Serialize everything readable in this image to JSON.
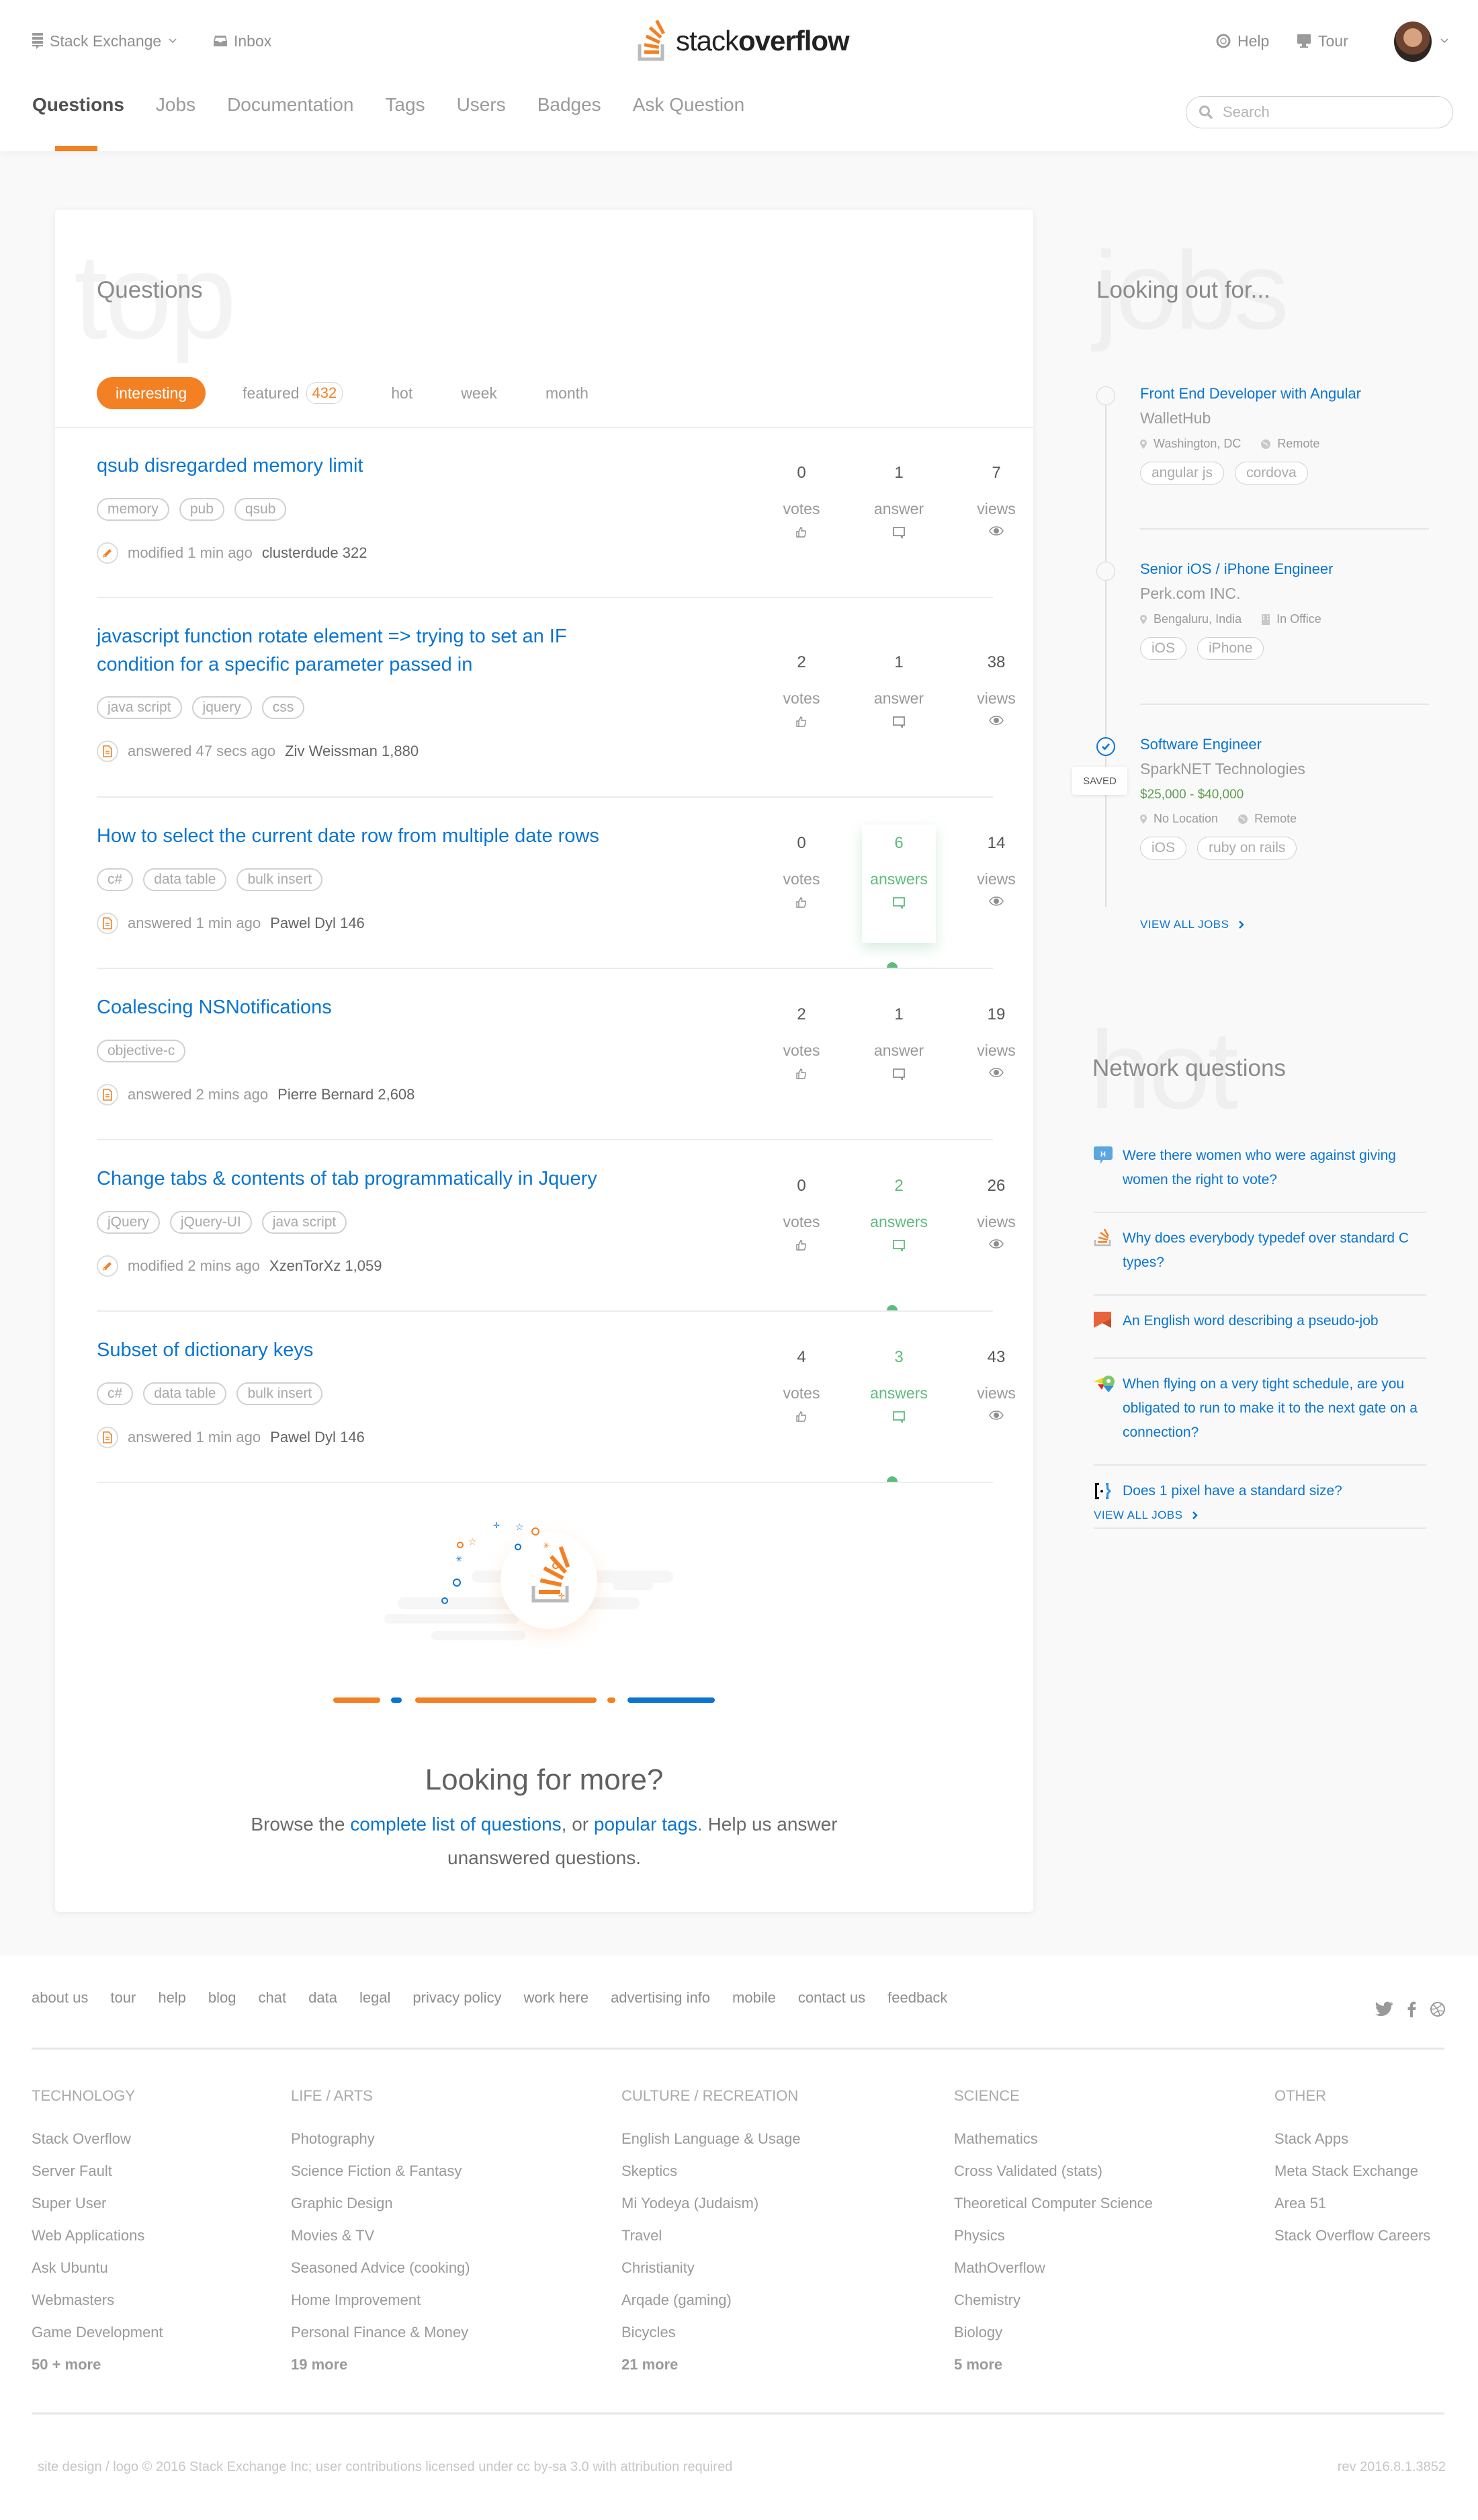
{
  "header": {
    "stack_exchange_label": "Stack Exchange",
    "inbox_label": "Inbox",
    "logo_text_light": "stack",
    "logo_text_bold": "overflow",
    "help_label": "Help",
    "tour_label": "Tour",
    "nav": [
      {
        "label": "Questions",
        "active": true
      },
      {
        "label": "Jobs"
      },
      {
        "label": "Documentation"
      },
      {
        "label": "Tags"
      },
      {
        "label": "Users"
      },
      {
        "label": "Badges"
      },
      {
        "label": "Ask Question"
      }
    ],
    "search_placeholder": "Search"
  },
  "main": {
    "watermark": "top",
    "title": "Questions",
    "filters": [
      {
        "label": "interesting",
        "active": true
      },
      {
        "label": "featured",
        "badge": "432"
      },
      {
        "label": "hot"
      },
      {
        "label": "week"
      },
      {
        "label": "month"
      }
    ],
    "questions": [
      {
        "title": "qsub disregarded memory limit",
        "tags": [
          "memory",
          "pub",
          "qsub"
        ],
        "action": "modified",
        "time": "1 min ago",
        "user": "clusterdude",
        "rep": "322",
        "action_icon": "pencil-icon",
        "votes": "0",
        "votes_label": "votes",
        "answers": "1",
        "answers_label": "answer",
        "answers_highlight": false,
        "accepted": false,
        "views": "7",
        "views_label": "views"
      },
      {
        "title": "javascript function rotate element => trying to set an IF condition for a specific parameter passed in",
        "tags": [
          "java script",
          "jquery",
          "css"
        ],
        "action": "answered",
        "time": "47 secs ago",
        "user": "Ziv Weissman",
        "rep": "1,880",
        "action_icon": "document-icon",
        "votes": "2",
        "votes_label": "votes",
        "answers": "1",
        "answers_label": "answer",
        "answers_highlight": false,
        "accepted": false,
        "views": "38",
        "views_label": "views"
      },
      {
        "title": "How to select the current date row from multiple date rows",
        "tags": [
          "c#",
          "data table",
          "bulk insert"
        ],
        "action": "answered",
        "time": "1 min ago",
        "user": "Pawel Dyl",
        "rep": "146",
        "action_icon": "document-icon",
        "votes": "0",
        "votes_label": "votes",
        "answers": "6",
        "answers_label": "answers",
        "answers_highlight": true,
        "accepted": true,
        "views": "14",
        "views_label": "views"
      },
      {
        "title": "Coalescing NSNotifications",
        "tags": [
          "objective-c"
        ],
        "action": "answered",
        "time": "2 mins ago",
        "user": "Pierre Bernard",
        "rep": "2,608",
        "action_icon": "document-icon",
        "votes": "2",
        "votes_label": "votes",
        "answers": "1",
        "answers_label": "answer",
        "answers_highlight": false,
        "accepted": false,
        "views": "19",
        "views_label": "views"
      },
      {
        "title": "Change tabs & contents of tab programmatically in Jquery",
        "tags": [
          "jQuery",
          "jQuery-UI",
          "java script"
        ],
        "action": "modified",
        "time": "2 mins ago",
        "user": "XzenTorXz",
        "rep": "1,059",
        "action_icon": "pencil-icon",
        "votes": "0",
        "votes_label": "votes",
        "answers": "2",
        "answers_label": "answers",
        "answers_highlight": false,
        "accepted": true,
        "views": "26",
        "views_label": "views"
      },
      {
        "title": "Subset of dictionary keys",
        "tags": [
          "c#",
          "data table",
          "bulk insert"
        ],
        "action": "answered",
        "time": "1 min ago",
        "user": "Pawel Dyl",
        "rep": "146",
        "action_icon": "document-icon",
        "votes": "4",
        "votes_label": "votes",
        "answers": "3",
        "answers_label": "answers",
        "answers_highlight": false,
        "accepted": true,
        "views": "43",
        "views_label": "views"
      }
    ],
    "more": {
      "title": "Looking for more?",
      "text_before": "Browse the ",
      "link1": "complete list of questions",
      "text_middle": ", or ",
      "link2": "popular tags",
      "text_after": ". Help us answer unanswered questions."
    }
  },
  "sidebar": {
    "jobs_watermark": "jobs",
    "jobs_title": "Looking out for...",
    "jobs": [
      {
        "title": "Front End Developer with Angular",
        "company": "WalletHub",
        "salary": null,
        "location": "Washington, DC",
        "mode": "Remote",
        "mode_icon": "globe-icon",
        "tags": [
          "angular js",
          "cordova"
        ],
        "saved": false
      },
      {
        "title": "Senior iOS / iPhone Engineer",
        "company": "Perk.com INC.",
        "salary": null,
        "location": "Bengaluru, India",
        "mode": "In Office",
        "mode_icon": "building-icon",
        "tags": [
          "iOS",
          "iPhone"
        ],
        "saved": false
      },
      {
        "title": "Software Engineer",
        "company": "SparkNET Technologies",
        "salary": "$25,000 - $40,000",
        "location": "No Location",
        "mode": "Remote",
        "mode_icon": "globe-icon",
        "tags": [
          "iOS",
          "ruby on rails"
        ],
        "saved": true
      }
    ],
    "saved_label": "SAVED",
    "view_all_jobs": "VIEW ALL JOBS",
    "hot_watermark": "hot",
    "network_title": "Network questions",
    "network_questions": [
      {
        "title": "Were there women who were against giving women the right to vote?",
        "site_icon": "history-site-icon"
      },
      {
        "title": "Why does everybody typedef over standard C types?",
        "site_icon": "stackoverflow-site-icon"
      },
      {
        "title": "An English word describing a pseudo-job",
        "site_icon": "english-site-icon"
      },
      {
        "title": "When flying on a very tight schedule, are you obligated to run to make it to the next gate on a connection?",
        "site_icon": "travel-site-icon"
      },
      {
        "title": "Does 1 pixel have a standard size?",
        "site_icon": "graphic-design-site-icon"
      }
    ],
    "view_all_network": "VIEW ALL JOBS"
  },
  "footer": {
    "links": [
      "about us",
      "tour",
      "help",
      "blog",
      "chat",
      "data",
      "legal",
      "privacy policy",
      "work here",
      "advertising info",
      "mobile",
      "contact us",
      "feedback"
    ],
    "social": [
      "twitter-icon",
      "facebook-icon",
      "dribbble-icon"
    ],
    "columns": [
      {
        "heading": "TECHNOLOGY",
        "items": [
          "Stack Overflow",
          "Server Fault",
          "Super User",
          "Web Applications",
          "Ask Ubuntu",
          "Webmasters",
          "Game Development"
        ],
        "more": "50 + more"
      },
      {
        "heading": "LIFE / ARTS",
        "items": [
          "Photography",
          "Science Fiction & Fantasy",
          "Graphic Design",
          "Movies & TV",
          "Seasoned Advice (cooking)",
          "Home Improvement",
          "Personal Finance & Money"
        ],
        "more": "19 more"
      },
      {
        "heading": "CULTURE / RECREATION",
        "items": [
          "English Language & Usage",
          "Skeptics",
          "Mi Yodeya (Judaism)",
          "Travel",
          "Christianity",
          "Arqade (gaming)",
          "Bicycles"
        ],
        "more": "21 more"
      },
      {
        "heading": "SCIENCE",
        "items": [
          "Mathematics",
          "Cross Validated (stats)",
          "Theoretical Computer Science",
          "Physics",
          "MathOverflow",
          "Chemistry",
          "Biology"
        ],
        "more": "5 more"
      },
      {
        "heading": "OTHER",
        "items": [
          "Stack Apps",
          "Meta Stack Exchange",
          "Area 51",
          "Stack Overflow Careers"
        ],
        "more": null
      }
    ],
    "copyright": "site design / logo © 2016 Stack Exchange Inc; user contributions licensed under cc by-sa 3.0 with attribution required",
    "rev": "rev 2016.8.1.3852"
  },
  "colors": {
    "accent": "#f48024",
    "link": "#0a75d1",
    "accepted": "#5eba7d",
    "salary": "#5e9e4f"
  }
}
